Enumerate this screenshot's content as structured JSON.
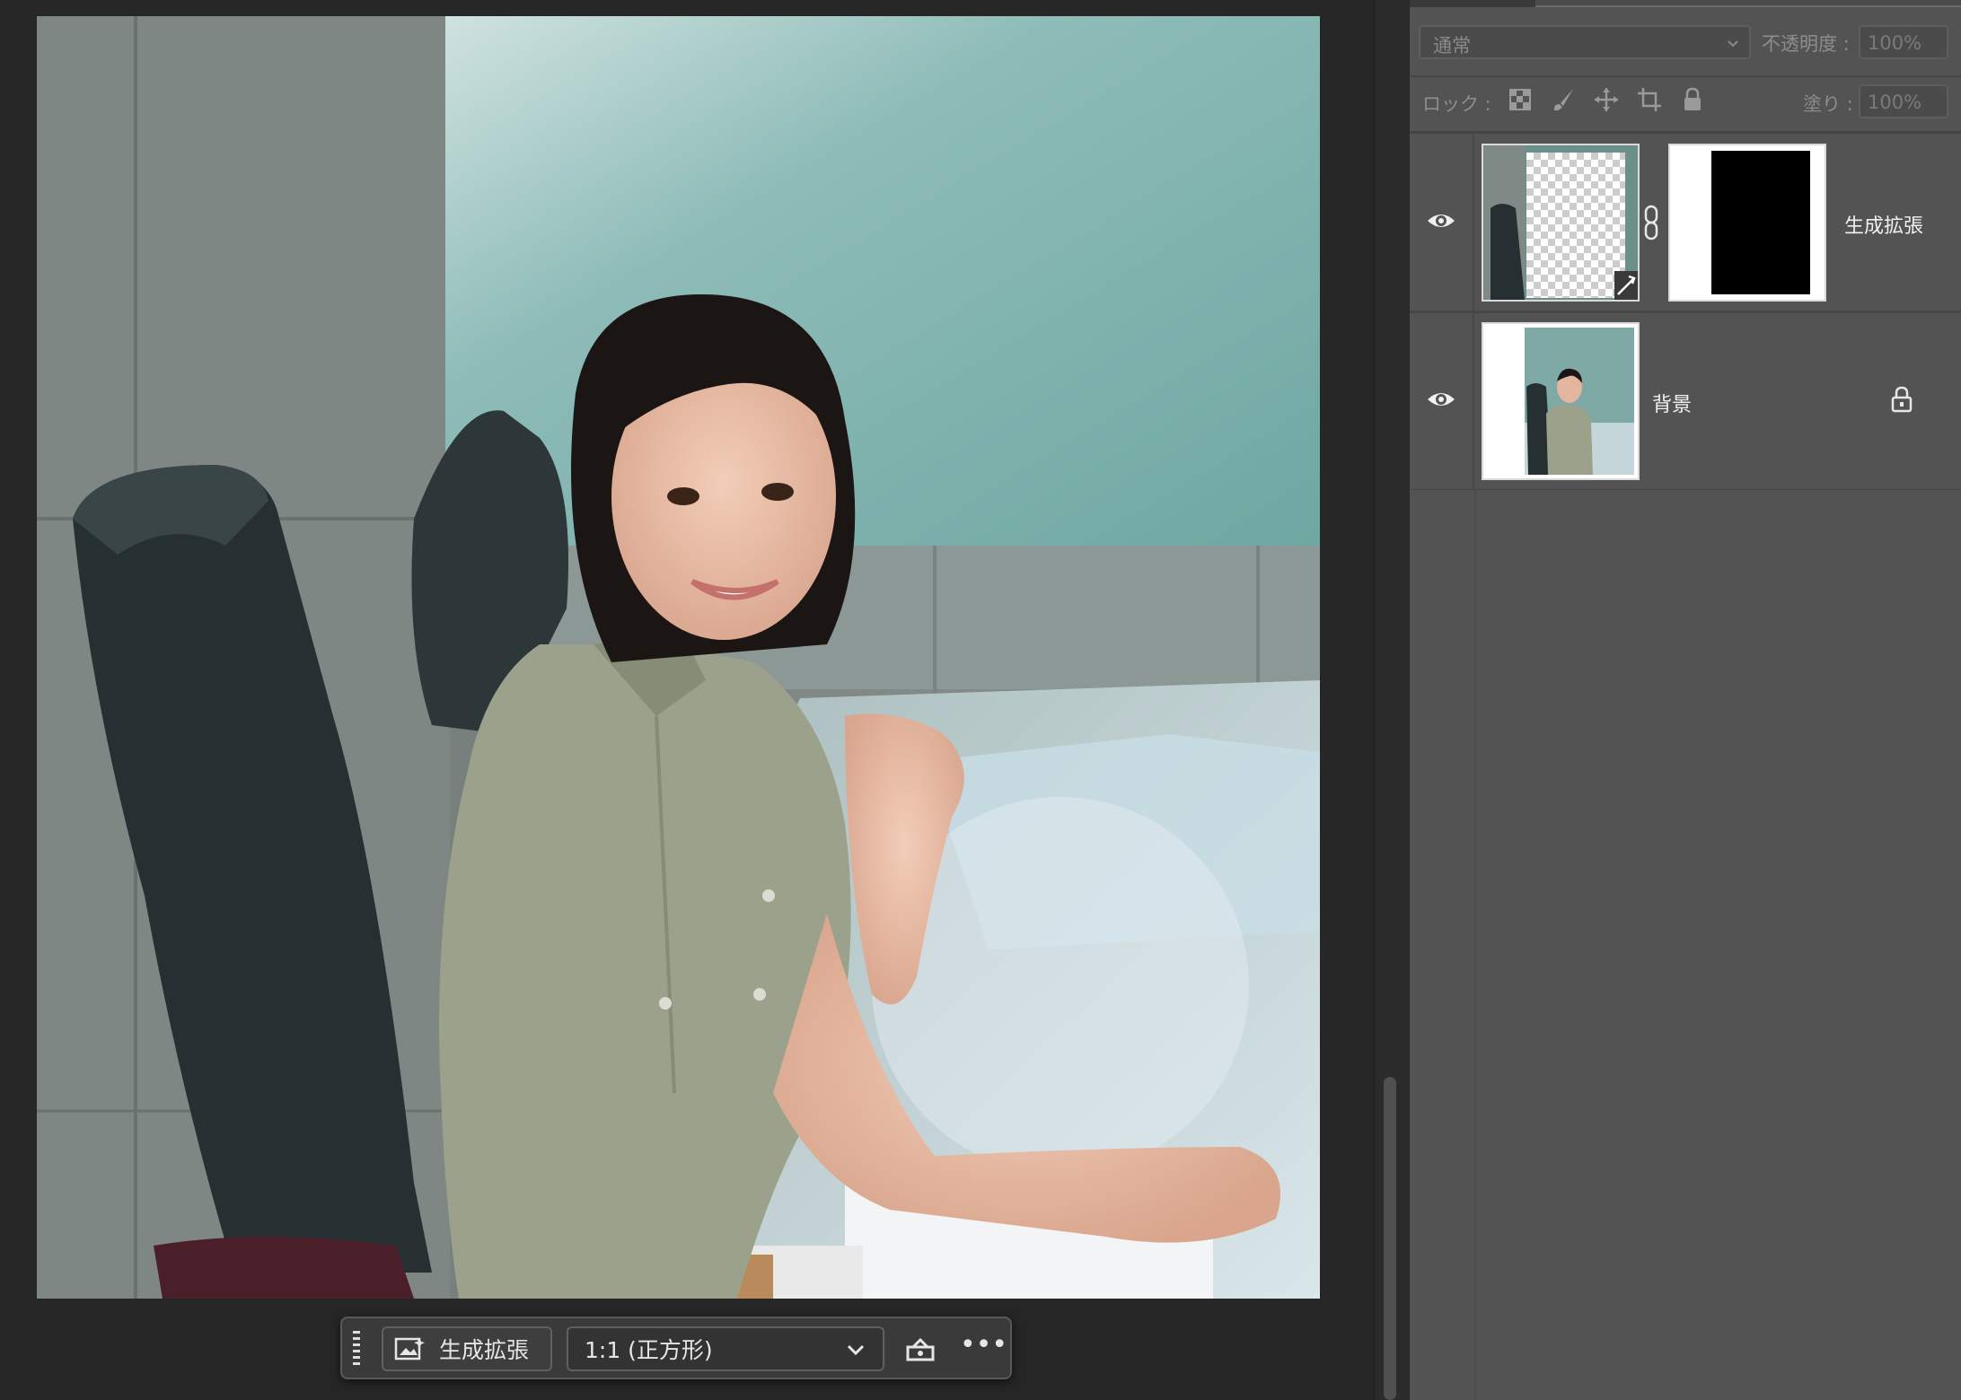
{
  "taskbar": {
    "generate_label": "生成拡張",
    "ratio_value": "1:1 (正方形)",
    "more_label": "•••"
  },
  "layers_panel": {
    "blend_mode": "通常",
    "opacity_label": "不透明度 :",
    "opacity_value": "100%",
    "lock_label": "ロック :",
    "fill_label": "塗り :",
    "fill_value": "100%",
    "lock_icons": [
      "lock-transparent-icon",
      "lock-paint-icon",
      "lock-position-icon",
      "lock-artboard-icon",
      "lock-all-icon"
    ],
    "layers": [
      {
        "name": "生成拡張",
        "visible": true,
        "has_mask": true,
        "locked": false
      },
      {
        "name": "背景",
        "visible": true,
        "has_mask": false,
        "locked": true
      }
    ]
  },
  "colors": {
    "panel_bg": "#535353",
    "app_bg": "#262626",
    "taskbar_bg": "#3a3a3a"
  }
}
